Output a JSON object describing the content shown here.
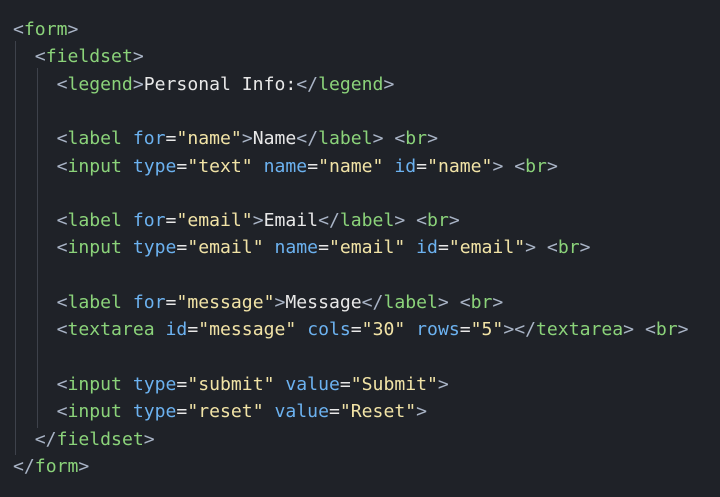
{
  "code_lines": [
    [
      {
        "t": "<",
        "c": "tb"
      },
      {
        "t": "form",
        "c": "tg"
      },
      {
        "t": ">",
        "c": "tb"
      }
    ],
    [
      {
        "t": "  <",
        "c": "tb"
      },
      {
        "t": "fieldset",
        "c": "tg"
      },
      {
        "t": ">",
        "c": "tb"
      }
    ],
    [
      {
        "t": "    <",
        "c": "tb"
      },
      {
        "t": "legend",
        "c": "tg"
      },
      {
        "t": ">",
        "c": "tb"
      },
      {
        "t": "Personal Info:",
        "c": "tx"
      },
      {
        "t": "</",
        "c": "tb"
      },
      {
        "t": "legend",
        "c": "tg"
      },
      {
        "t": ">",
        "c": "tb"
      }
    ],
    [],
    [
      {
        "t": "    <",
        "c": "tb"
      },
      {
        "t": "label",
        "c": "tg"
      },
      {
        "t": " ",
        "c": "tx"
      },
      {
        "t": "for",
        "c": "at"
      },
      {
        "t": "=",
        "c": "eq"
      },
      {
        "t": "\"name\"",
        "c": "st"
      },
      {
        "t": ">",
        "c": "tb"
      },
      {
        "t": "Name",
        "c": "tx"
      },
      {
        "t": "</",
        "c": "tb"
      },
      {
        "t": "label",
        "c": "tg"
      },
      {
        "t": ">",
        "c": "tb"
      },
      {
        "t": " <",
        "c": "tb"
      },
      {
        "t": "br",
        "c": "tg"
      },
      {
        "t": ">",
        "c": "tb"
      }
    ],
    [
      {
        "t": "    <",
        "c": "tb"
      },
      {
        "t": "input",
        "c": "tg"
      },
      {
        "t": " ",
        "c": "tx"
      },
      {
        "t": "type",
        "c": "at"
      },
      {
        "t": "=",
        "c": "eq"
      },
      {
        "t": "\"text\"",
        "c": "st"
      },
      {
        "t": " ",
        "c": "tx"
      },
      {
        "t": "name",
        "c": "at"
      },
      {
        "t": "=",
        "c": "eq"
      },
      {
        "t": "\"name\"",
        "c": "st"
      },
      {
        "t": " ",
        "c": "tx"
      },
      {
        "t": "id",
        "c": "at"
      },
      {
        "t": "=",
        "c": "eq"
      },
      {
        "t": "\"name\"",
        "c": "st"
      },
      {
        "t": ">",
        "c": "tb"
      },
      {
        "t": " <",
        "c": "tb"
      },
      {
        "t": "br",
        "c": "tg"
      },
      {
        "t": ">",
        "c": "tb"
      }
    ],
    [],
    [
      {
        "t": "    <",
        "c": "tb"
      },
      {
        "t": "label",
        "c": "tg"
      },
      {
        "t": " ",
        "c": "tx"
      },
      {
        "t": "for",
        "c": "at"
      },
      {
        "t": "=",
        "c": "eq"
      },
      {
        "t": "\"email\"",
        "c": "st"
      },
      {
        "t": ">",
        "c": "tb"
      },
      {
        "t": "Email",
        "c": "tx"
      },
      {
        "t": "</",
        "c": "tb"
      },
      {
        "t": "label",
        "c": "tg"
      },
      {
        "t": ">",
        "c": "tb"
      },
      {
        "t": " <",
        "c": "tb"
      },
      {
        "t": "br",
        "c": "tg"
      },
      {
        "t": ">",
        "c": "tb"
      }
    ],
    [
      {
        "t": "    <",
        "c": "tb"
      },
      {
        "t": "input",
        "c": "tg"
      },
      {
        "t": " ",
        "c": "tx"
      },
      {
        "t": "type",
        "c": "at"
      },
      {
        "t": "=",
        "c": "eq"
      },
      {
        "t": "\"email\"",
        "c": "st"
      },
      {
        "t": " ",
        "c": "tx"
      },
      {
        "t": "name",
        "c": "at"
      },
      {
        "t": "=",
        "c": "eq"
      },
      {
        "t": "\"email\"",
        "c": "st"
      },
      {
        "t": " ",
        "c": "tx"
      },
      {
        "t": "id",
        "c": "at"
      },
      {
        "t": "=",
        "c": "eq"
      },
      {
        "t": "\"email\"",
        "c": "st"
      },
      {
        "t": ">",
        "c": "tb"
      },
      {
        "t": " <",
        "c": "tb"
      },
      {
        "t": "br",
        "c": "tg"
      },
      {
        "t": ">",
        "c": "tb"
      }
    ],
    [],
    [
      {
        "t": "    <",
        "c": "tb"
      },
      {
        "t": "label",
        "c": "tg"
      },
      {
        "t": " ",
        "c": "tx"
      },
      {
        "t": "for",
        "c": "at"
      },
      {
        "t": "=",
        "c": "eq"
      },
      {
        "t": "\"message\"",
        "c": "st"
      },
      {
        "t": ">",
        "c": "tb"
      },
      {
        "t": "Message",
        "c": "tx"
      },
      {
        "t": "</",
        "c": "tb"
      },
      {
        "t": "label",
        "c": "tg"
      },
      {
        "t": ">",
        "c": "tb"
      },
      {
        "t": " <",
        "c": "tb"
      },
      {
        "t": "br",
        "c": "tg"
      },
      {
        "t": ">",
        "c": "tb"
      }
    ],
    [
      {
        "t": "    <",
        "c": "tb"
      },
      {
        "t": "textarea",
        "c": "tg"
      },
      {
        "t": " ",
        "c": "tx"
      },
      {
        "t": "id",
        "c": "at"
      },
      {
        "t": "=",
        "c": "eq"
      },
      {
        "t": "\"message\"",
        "c": "st"
      },
      {
        "t": " ",
        "c": "tx"
      },
      {
        "t": "cols",
        "c": "at"
      },
      {
        "t": "=",
        "c": "eq"
      },
      {
        "t": "\"30\"",
        "c": "st"
      },
      {
        "t": " ",
        "c": "tx"
      },
      {
        "t": "rows",
        "c": "at"
      },
      {
        "t": "=",
        "c": "eq"
      },
      {
        "t": "\"5\"",
        "c": "st"
      },
      {
        "t": "></",
        "c": "tb"
      },
      {
        "t": "textarea",
        "c": "tg"
      },
      {
        "t": ">",
        "c": "tb"
      },
      {
        "t": " <",
        "c": "tb"
      },
      {
        "t": "br",
        "c": "tg"
      },
      {
        "t": ">",
        "c": "tb"
      }
    ],
    [],
    [
      {
        "t": "    <",
        "c": "tb"
      },
      {
        "t": "input",
        "c": "tg"
      },
      {
        "t": " ",
        "c": "tx"
      },
      {
        "t": "type",
        "c": "at"
      },
      {
        "t": "=",
        "c": "eq"
      },
      {
        "t": "\"submit\"",
        "c": "st"
      },
      {
        "t": " ",
        "c": "tx"
      },
      {
        "t": "value",
        "c": "at"
      },
      {
        "t": "=",
        "c": "eq"
      },
      {
        "t": "\"Submit\"",
        "c": "st"
      },
      {
        "t": ">",
        "c": "tb"
      }
    ],
    [
      {
        "t": "    <",
        "c": "tb"
      },
      {
        "t": "input",
        "c": "tg"
      },
      {
        "t": " ",
        "c": "tx"
      },
      {
        "t": "type",
        "c": "at"
      },
      {
        "t": "=",
        "c": "eq"
      },
      {
        "t": "\"reset\"",
        "c": "st"
      },
      {
        "t": " ",
        "c": "tx"
      },
      {
        "t": "value",
        "c": "at"
      },
      {
        "t": "=",
        "c": "eq"
      },
      {
        "t": "\"Reset\"",
        "c": "st"
      },
      {
        "t": ">",
        "c": "tb"
      }
    ],
    [
      {
        "t": "  </",
        "c": "tb"
      },
      {
        "t": "fieldset",
        "c": "tg"
      },
      {
        "t": ">",
        "c": "tb"
      }
    ],
    [
      {
        "t": "</",
        "c": "tb"
      },
      {
        "t": "form",
        "c": "tg"
      },
      {
        "t": ">",
        "c": "tb"
      }
    ]
  ],
  "colors": {
    "background": "#1f2228",
    "angle_bracket": "#a9b4c6",
    "tag_name": "#8bd37a",
    "attribute_name": "#6cb2f0",
    "attribute_value": "#f1e3a6",
    "text": "#e8e8e8"
  }
}
